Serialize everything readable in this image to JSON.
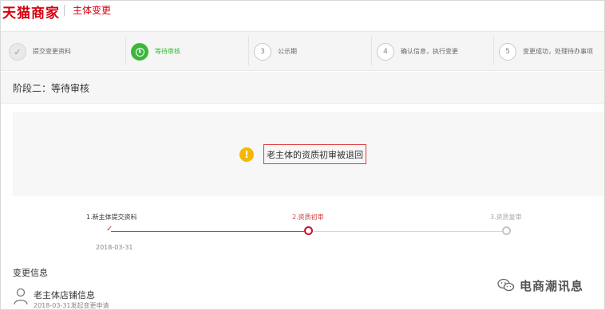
{
  "header": {
    "logo": "天猫商家",
    "title": "主体变更"
  },
  "steps": [
    {
      "number": "✓",
      "label": "提交变更资料",
      "state": "done"
    },
    {
      "number": "",
      "label": "等待审核",
      "state": "active"
    },
    {
      "number": "3",
      "label": "公示期",
      "state": "pending"
    },
    {
      "number": "4",
      "label": "确认信息，执行变更",
      "state": "pending"
    },
    {
      "number": "5",
      "label": "变更成功，处理待办事项",
      "state": "pending"
    }
  ],
  "stage": {
    "title": "阶段二：等待审核"
  },
  "notice": {
    "icon": "warning-icon",
    "text": "老主体的资质初审被退回",
    "highlight_color": "#e03a3a"
  },
  "timeline": {
    "nodes": [
      {
        "label": "1.新主体提交资料",
        "date": "2018-03-31",
        "state": "done"
      },
      {
        "label": "2.资质初审",
        "state": "current"
      },
      {
        "label": "3.资质复审",
        "state": "future"
      }
    ]
  },
  "change_info": {
    "section_title": "变更信息",
    "record_title": "老主体店铺信息",
    "record_subtitle": "2018-03-31发起变更申请"
  },
  "watermark": {
    "text": "电商潮讯息",
    "icon": "wechat-icon"
  },
  "colors": {
    "brand_red": "#d7000f",
    "active_green": "#3ab83a",
    "warning_yellow": "#f5b800",
    "progress_red": "#d23c3c"
  }
}
